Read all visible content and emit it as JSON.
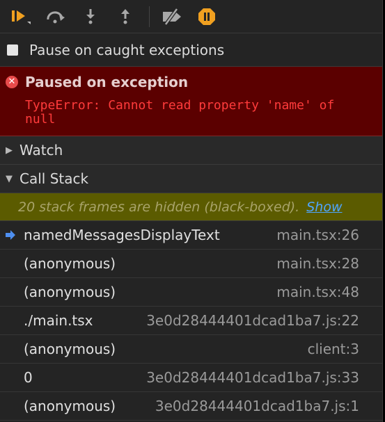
{
  "toolbar": {
    "buttons": [
      {
        "name": "resume-icon",
        "color": "#f0a020"
      },
      {
        "name": "step-over-icon",
        "color": "#a8a8a8"
      },
      {
        "name": "step-into-icon",
        "color": "#a8a8a8"
      },
      {
        "name": "step-out-icon",
        "color": "#a8a8a8"
      },
      {
        "name": "deactivate-breakpoints-icon",
        "color": "#a8a8a8"
      },
      {
        "name": "pause-on-exceptions-icon",
        "color": "#f0a020"
      }
    ]
  },
  "pause_caught": {
    "label": "Pause on caught exceptions",
    "checked": false
  },
  "exception": {
    "title": "Paused on exception",
    "message": "TypeError: Cannot read property 'name' of null",
    "bg_color": "#5b0000",
    "text_color": "#ff3b3b"
  },
  "watch": {
    "label": "Watch",
    "expanded": false
  },
  "call_stack": {
    "label": "Call Stack",
    "expanded": true,
    "hidden_notice": "20 stack frames are hidden (black-boxed).",
    "show_link": "Show",
    "frames": [
      {
        "name": "namedMessagesDisplayText",
        "location": "main.tsx:26",
        "current": true
      },
      {
        "name": "(anonymous)",
        "location": "main.tsx:28",
        "current": false
      },
      {
        "name": "(anonymous)",
        "location": "main.tsx:48",
        "current": false
      },
      {
        "name": "./main.tsx",
        "location": "3e0d28444401dcad1ba7.js:22",
        "current": false
      },
      {
        "name": "(anonymous)",
        "location": "client:3",
        "current": false
      },
      {
        "name": "0",
        "location": "3e0d28444401dcad1ba7.js:33",
        "current": false
      },
      {
        "name": "(anonymous)",
        "location": "3e0d28444401dcad1ba7.js:1",
        "current": false
      }
    ]
  }
}
